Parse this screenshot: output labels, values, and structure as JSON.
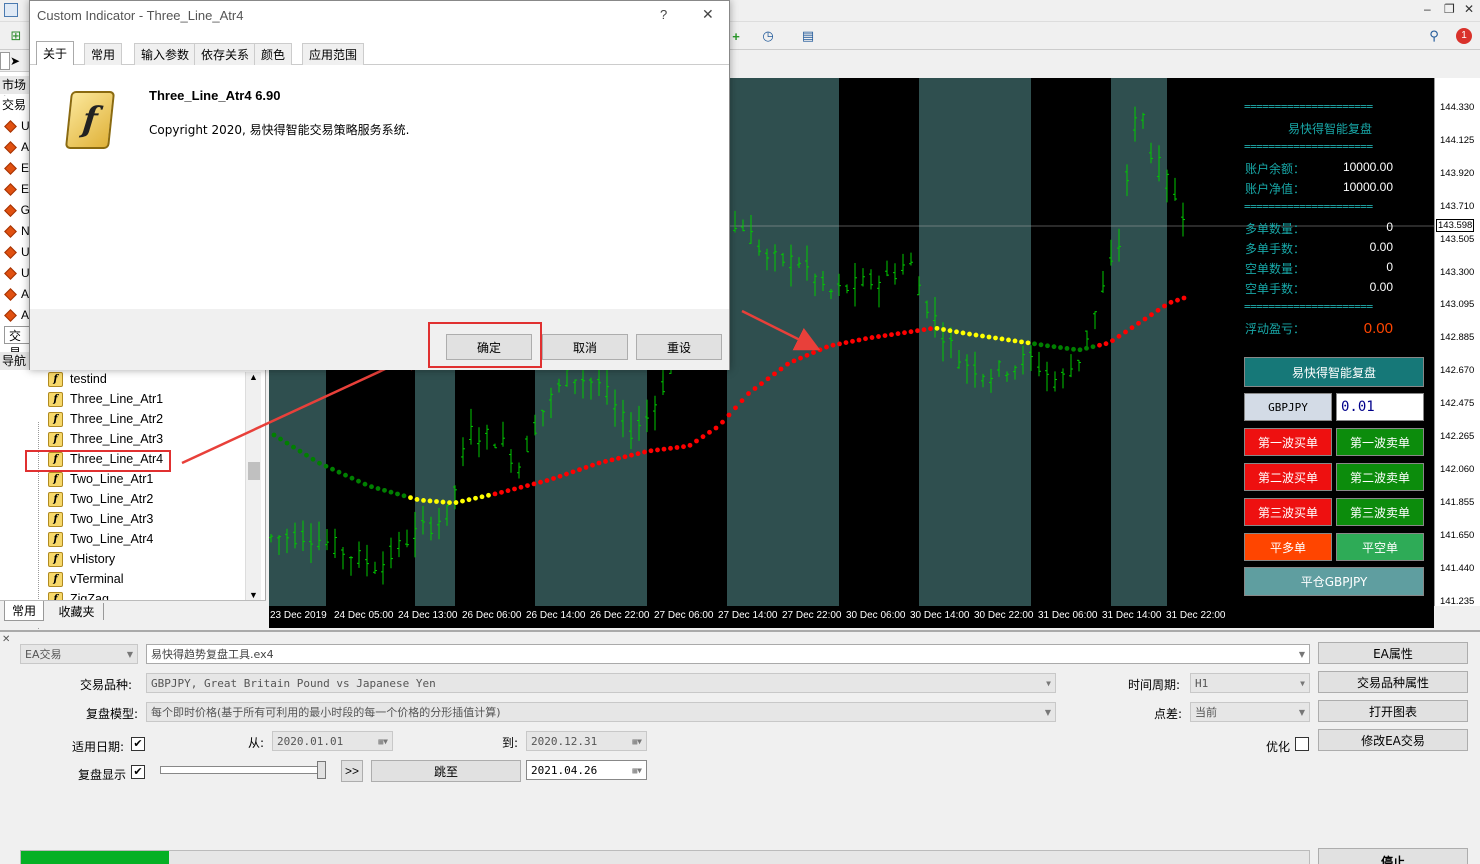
{
  "dialog": {
    "title": "Custom Indicator - Three_Line_Atr4",
    "help": "?",
    "close": "✕",
    "tabs": [
      "关于",
      "常用",
      "输入参数",
      "依存关系",
      "颜色",
      "应用范围"
    ],
    "indicator_name": "Three_Line_Atr4 6.90",
    "copyright": "Copyright 2020, 易快得智能交易策略服务系统.",
    "ok": "确定",
    "cancel": "取消",
    "reset": "重设"
  },
  "left_panel": {
    "head_market": "市场报价",
    "head_trade": "交易",
    "symbols": [
      "U",
      "A",
      "E",
      "E",
      "G",
      "N",
      "U",
      "U",
      "A",
      "A"
    ],
    "tab_trade": "交易",
    "nav_title": "导航",
    "tree": [
      "testind",
      "Three_Line_Atr1",
      "Three_Line_Atr2",
      "Three_Line_Atr3",
      "Three_Line_Atr4",
      "Two_Line_Atr1",
      "Two_Line_Atr2",
      "Two_Line_Atr3",
      "Two_Line_Atr4",
      "vHistory",
      "vTerminal",
      "ZigZag"
    ],
    "bottom_tabs": [
      "常用",
      "收藏夹"
    ]
  },
  "chart": {
    "x_labels": [
      "23 Dec 2019",
      "24 Dec 05:00",
      "24 Dec 13:00",
      "26 Dec 06:00",
      "26 Dec 14:00",
      "26 Dec 22:00",
      "27 Dec 06:00",
      "27 Dec 14:00",
      "27 Dec 22:00",
      "30 Dec 06:00",
      "30 Dec 14:00",
      "30 Dec 22:00",
      "31 Dec 06:00",
      "31 Dec 14:00",
      "31 Dec 22:00"
    ],
    "y_labels": [
      "144.330",
      "144.125",
      "143.920",
      "143.710",
      "143.505",
      "143.300",
      "143.095",
      "142.885",
      "142.670",
      "142.475",
      "142.265",
      "142.060",
      "141.855",
      "141.650",
      "141.440",
      "141.235"
    ],
    "current_price": "143.598"
  },
  "info": {
    "sep": "=====================",
    "title": "易快得智能复盘",
    "balance_label": "账户余额：",
    "balance": "10000.00",
    "equity_label": "账户净值：",
    "equity": "10000.00",
    "long_count_label": "多单数量：",
    "long_count": "0",
    "long_lots_label": "多单手数：",
    "long_lots": "0.00",
    "short_count_label": "空单数量：",
    "short_count": "0",
    "short_lots_label": "空单手数：",
    "short_lots": "0.00",
    "pnl_label": "浮动盈亏：",
    "pnl": "0.00"
  },
  "panel": {
    "title_btn": "易快得智能复盘",
    "symbol": "GBPJPY",
    "lot": "0.01",
    "buy1": "第一波买单",
    "sell1": "第一波卖单",
    "buy2": "第二波买单",
    "sell2": "第二波卖单",
    "buy3": "第三波买单",
    "sell3": "第三波卖单",
    "close_long": "平多单",
    "close_short": "平空单",
    "close_symbol": "平仓GBPJPY"
  },
  "tester": {
    "mode": "EA交易",
    "ea_file": "易快得趋势复盘工具.ex4",
    "symbol_label": "交易品种:",
    "symbol_value": "GBPJPY, Great Britain Pound vs Japanese Yen",
    "model_label": "复盘模型:",
    "model_value": "每个即时价格(基于所有可利用的最小时段的每一个价格的分形插值计算)",
    "use_date_label": "适用日期:",
    "from_label": "从:",
    "from_date": "2020.01.01",
    "to_label": "到:",
    "to_date": "2020.12.31",
    "visual_label": "复盘显示",
    "ff_btn": ">>",
    "jump_btn": "跳至",
    "jump_date": "2021.04.26",
    "period_label": "时间周期:",
    "period_value": "H1",
    "spread_label": "点差:",
    "spread_value": "当前",
    "optimize_label": "优化",
    "btn_ea_props": "EA属性",
    "btn_symbol_props": "交易品种属性",
    "btn_open_chart": "打开图表",
    "btn_modify_ea": "修改EA交易",
    "btn_stop": "停止",
    "progress": 0.115
  },
  "colors": {
    "chart_bg": "#000000",
    "band": "#2f4f4f",
    "candle": "#00c800",
    "dot_red": "#ff0000",
    "dot_yellow": "#ffff00",
    "dot_green": "#008000",
    "arrow": "#e8403a"
  }
}
